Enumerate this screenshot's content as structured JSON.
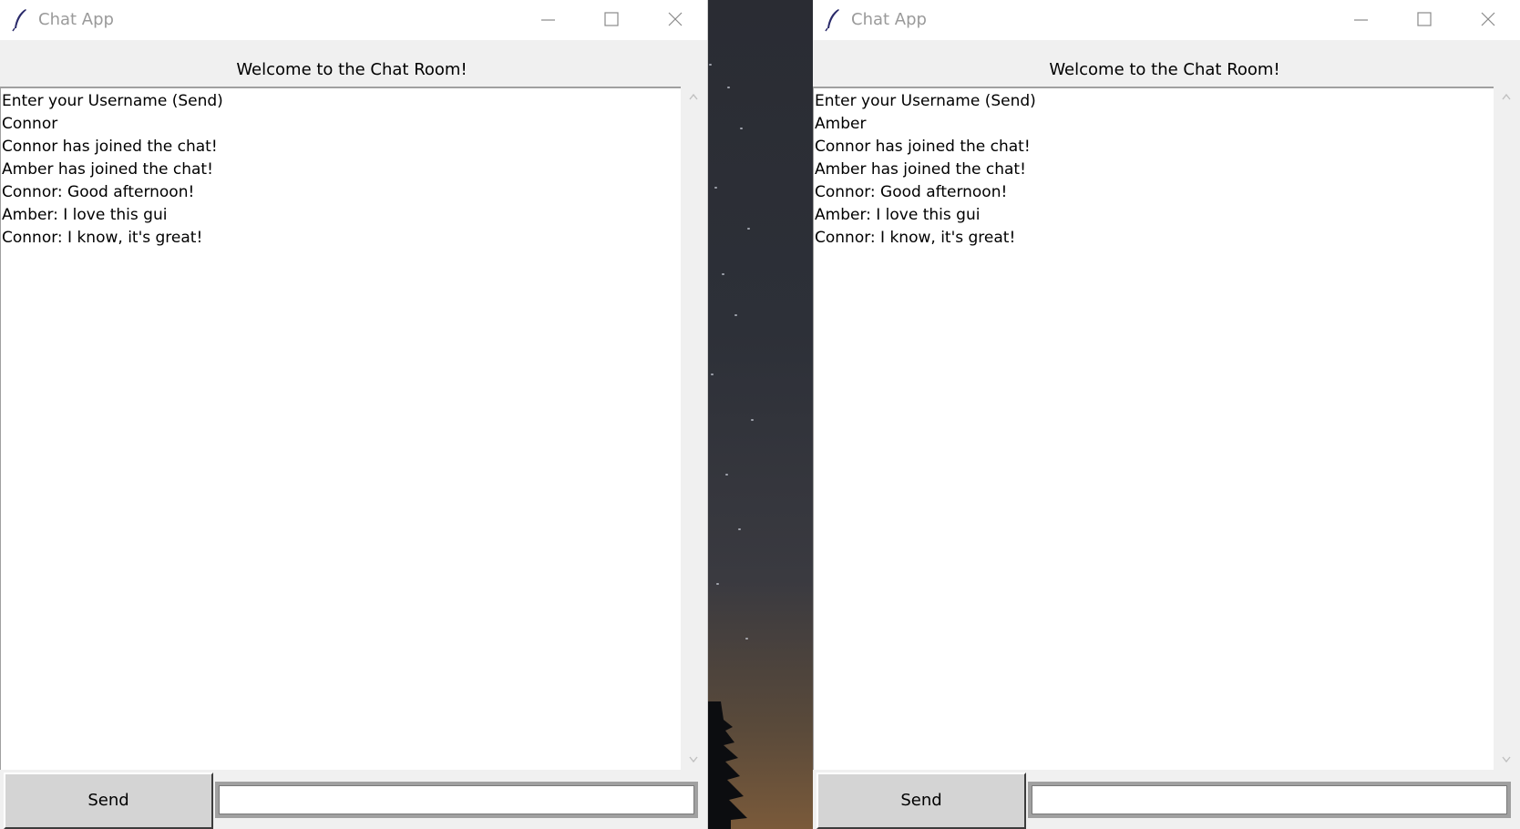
{
  "windows": [
    {
      "title": "Chat App",
      "welcome": "Welcome to the Chat Room!",
      "messages": [
        "Enter your Username (Send)",
        "Connor",
        "Connor has joined the chat!",
        "Amber has joined the chat!",
        "Connor: Good afternoon!",
        "Amber: I love this gui",
        "Connor: I know, it's great!"
      ],
      "send_label": "Send",
      "entry_value": ""
    },
    {
      "title": "Chat App",
      "welcome": "Welcome to the Chat Room!",
      "messages": [
        "Enter your Username (Send)",
        "Amber",
        "Connor has joined the chat!",
        "Amber has joined the chat!",
        "Connor: Good afternoon!",
        "Amber: I love this gui",
        "Connor: I know, it's great!"
      ],
      "send_label": "Send",
      "entry_value": ""
    }
  ],
  "icons": {
    "app": "feather-icon",
    "minimize": "minimize-icon",
    "maximize": "maximize-icon",
    "close": "close-icon",
    "scroll_up": "chevron-up-icon",
    "scroll_down": "chevron-down-icon"
  },
  "colors": {
    "titlebar_bg": "#ffffff",
    "window_bg": "#f0f0f0",
    "title_text": "#9a9a9a",
    "button_bg": "#d4d4d4"
  }
}
